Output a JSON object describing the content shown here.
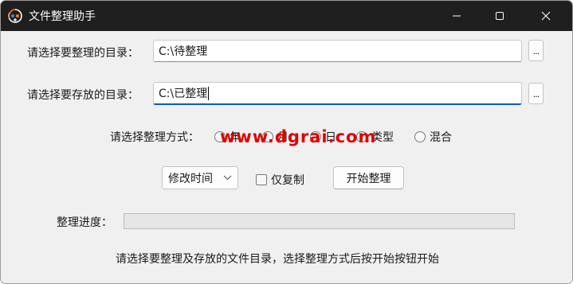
{
  "window": {
    "title": "文件整理助手",
    "icon": "app-logo-icon",
    "controls": [
      "minimize-icon",
      "maximize-icon",
      "close-icon"
    ]
  },
  "source": {
    "label": "请选择要整理的目录：",
    "value": "C:\\待整理",
    "browse_label": "..."
  },
  "target": {
    "label": "请选择要存放的目录：",
    "value": "C:\\已整理",
    "browse_label": "..."
  },
  "method": {
    "label": "请选择整理方式：",
    "options": [
      "年",
      "月",
      "日",
      "类型",
      "混合"
    ],
    "selected": null
  },
  "watermark": "www.dgrai.com",
  "options_row": {
    "time_select": "修改时间",
    "copy_only_label": "仅复制",
    "copy_only_checked": false,
    "start_button": "开始整理"
  },
  "progress": {
    "label": "整理进度：",
    "value": 0
  },
  "status": "请选择要整理及存放的文件目录，选择整理方式后按开始按钮开始",
  "colors": {
    "titlebar": "#1f1f1f",
    "accent": "#005fb8",
    "watermark": "#e00000",
    "window_bg": "#f0f0f0"
  }
}
